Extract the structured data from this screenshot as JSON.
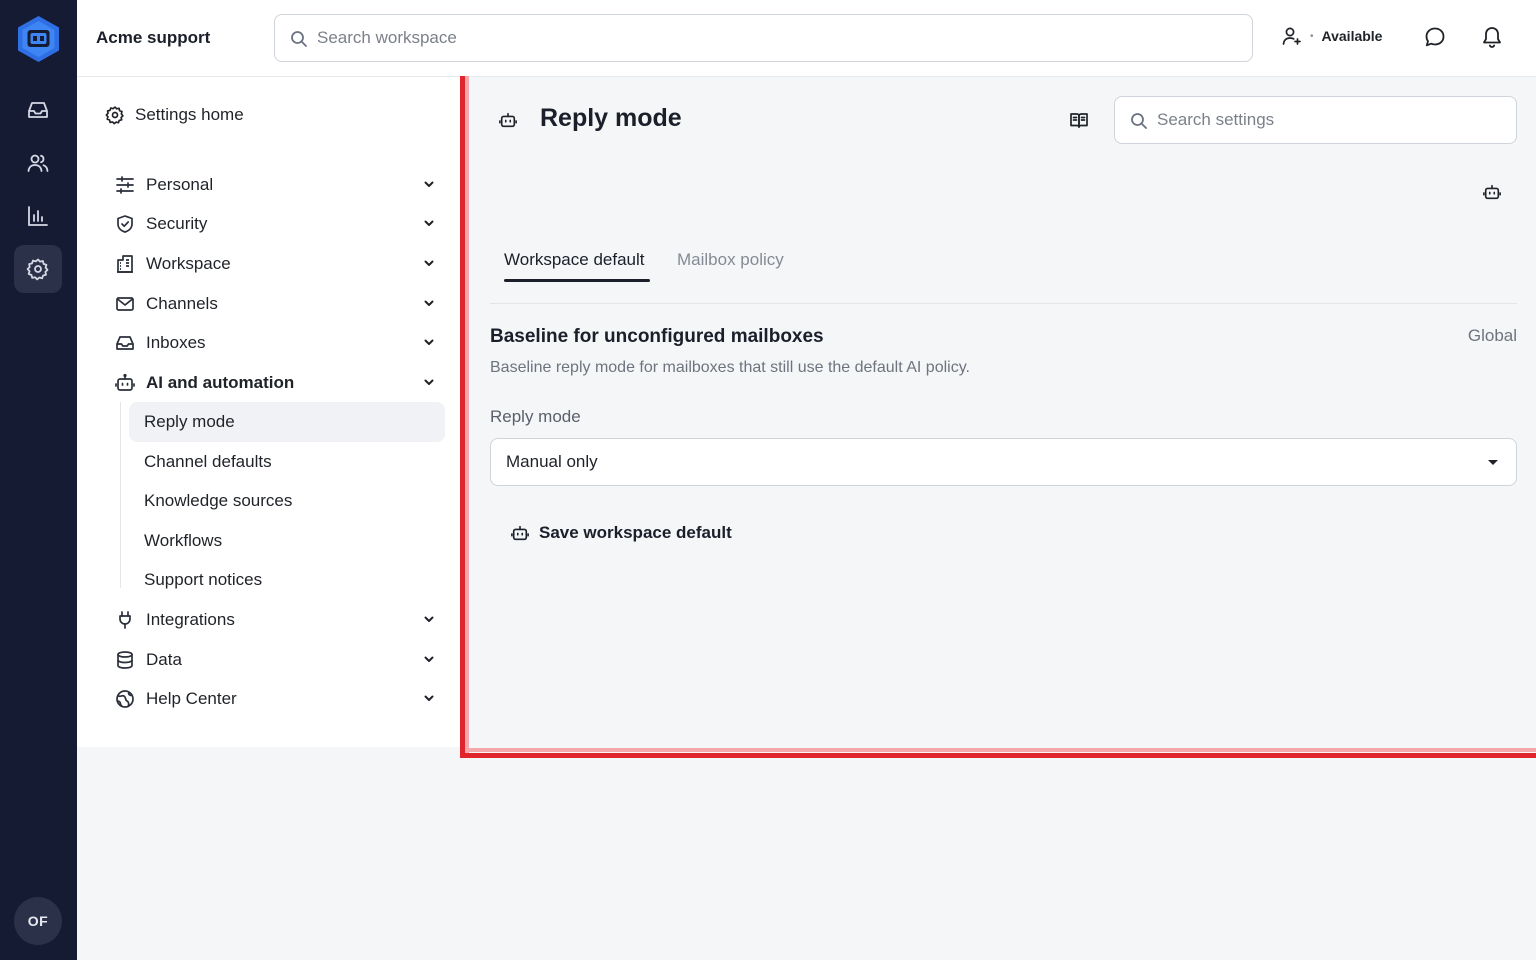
{
  "app": {
    "workspace_name": "Acme support",
    "search_placeholder": "Search workspace",
    "presence_status": "Available",
    "user_initials": "OF",
    "logo_icon": "robot-hex-logo",
    "rail_icons": [
      "inbox-icon",
      "people-icon",
      "bar-chart-icon",
      "gear-icon"
    ],
    "accent_color": "#2f6fe4",
    "rail_color": "#151b33"
  },
  "sidebar": {
    "home_label": "Settings home",
    "items": [
      {
        "label": "Personal",
        "icon": "sliders-icon"
      },
      {
        "label": "Security",
        "icon": "shield-icon"
      },
      {
        "label": "Workspace",
        "icon": "building-icon"
      },
      {
        "label": "Channels",
        "icon": "mail-icon"
      },
      {
        "label": "Inboxes",
        "icon": "inbox-icon"
      },
      {
        "label": "AI and automation",
        "icon": "robot-icon"
      },
      {
        "label": "Integrations",
        "icon": "plug-icon"
      },
      {
        "label": "Data",
        "icon": "database-icon"
      },
      {
        "label": "Help Center",
        "icon": "globe-icon"
      }
    ],
    "ai_subitems": [
      {
        "label": "Reply mode"
      },
      {
        "label": "Channel defaults"
      },
      {
        "label": "Knowledge sources"
      },
      {
        "label": "Workflows"
      },
      {
        "label": "Support notices"
      }
    ]
  },
  "main": {
    "title": "Reply mode",
    "search_placeholder": "Search settings",
    "tabs": [
      {
        "label": "Workspace default"
      },
      {
        "label": "Mailbox policy"
      }
    ],
    "section": {
      "title": "Baseline for unconfigured mailboxes",
      "badge": "Global",
      "description": "Baseline reply mode for mailboxes that still use the default AI policy.",
      "field_label": "Reply mode",
      "selected_value": "Manual only",
      "save_label": "Save workspace default"
    },
    "highlight_color": "#e0252c"
  }
}
